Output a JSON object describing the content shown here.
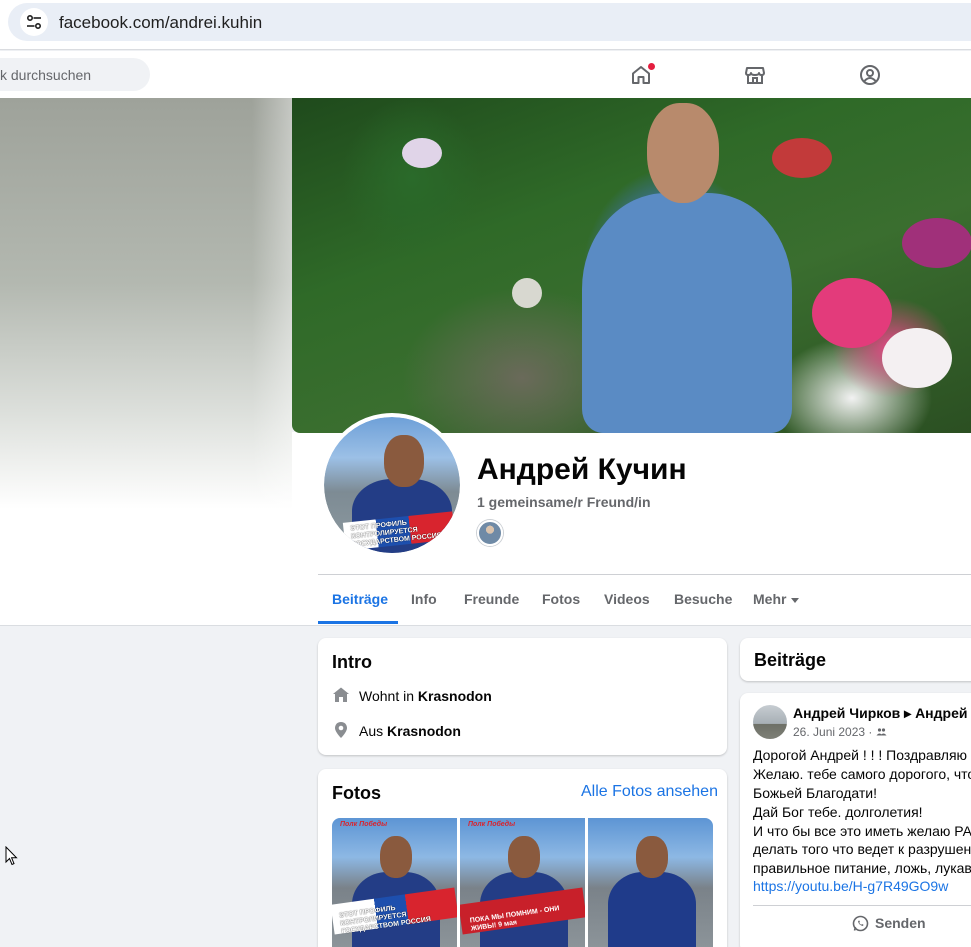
{
  "browser": {
    "url": "facebook.com/andrei.kuhin"
  },
  "fbnav": {
    "search_placeholder": "k durchsuchen",
    "icons": [
      "home-icon",
      "marketplace-icon",
      "groups-icon"
    ]
  },
  "profile": {
    "name": "Андрей Кучин",
    "mutual_friends": "1 gemeinsame/r Freund/in",
    "avatar_banner": "ЭТОТ ПРОФИЛЬ КОНТРОЛИРУЕТСЯ ГОСУДАРСТВОМ РОССИЯ"
  },
  "tabs": [
    {
      "label": "Beiträge",
      "active": true
    },
    {
      "label": "Info"
    },
    {
      "label": "Freunde"
    },
    {
      "label": "Fotos"
    },
    {
      "label": "Videos"
    },
    {
      "label": "Besuche"
    },
    {
      "label": "Mehr"
    }
  ],
  "intro": {
    "title": "Intro",
    "lives_prefix": "Wohnt in ",
    "lives_city": "Krasnodon",
    "from_prefix": "Aus ",
    "from_city": "Krasnodon"
  },
  "photos": {
    "title": "Fotos",
    "see_all": "Alle Fotos ansehen",
    "items": [
      {
        "caption": "Полк Победы",
        "banner": "ЭТОТ ПРОФИЛЬ КОНТРОЛИРУЕТСЯ ГОСУДАРСТВОМ РОССИЯ"
      },
      {
        "caption": "Полк Победы",
        "banner": "ПОКА МЫ ПОМНИМ - ОНИ ЖИВЫ! 9 мая"
      },
      {
        "caption": "",
        "banner": ""
      }
    ]
  },
  "posts": {
    "title": "Beiträge",
    "author": "Андрей Чирков ▸ Андрей К",
    "date": "26. Juni 2023 · ",
    "lines": [
      "Дорогой Андрей !   ! ! Поздравляю",
      "Желаю. тебе самого дорогого, что",
      "Божьей Благодати!",
      "Дай Бог тебе. долголетия!",
      "И что бы все это иметь желаю РА",
      "делать того что ведет к разрушен",
      "правильное питание, ложь, лукав"
    ],
    "link": "https://youtu.be/H-g7R49GO9w",
    "send_label": "Senden"
  },
  "colors": {
    "accent": "#1b74e4",
    "secondary_text": "#65676b",
    "page_bg": "#f0f2f5"
  }
}
